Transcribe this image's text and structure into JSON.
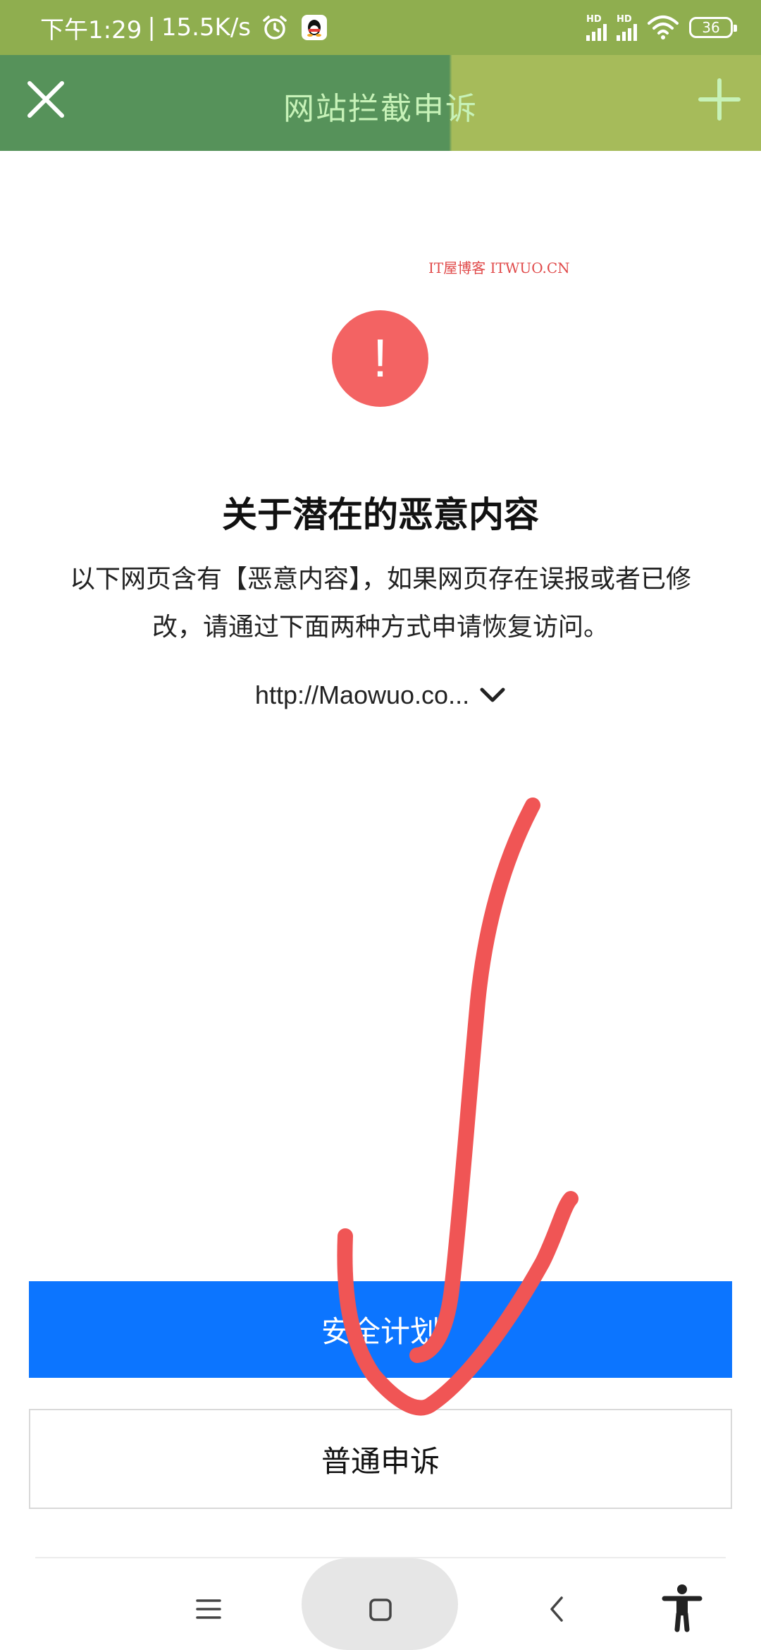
{
  "status_bar": {
    "time": "下午1:29",
    "separator": "|",
    "network_speed": "15.5K/s",
    "signal_label_1": "HD",
    "signal_label_2": "HD",
    "battery": "36",
    "icons": [
      "alarm-icon",
      "qq-icon",
      "signal-icon",
      "wifi-icon",
      "battery-icon"
    ]
  },
  "title_bar": {
    "title": "网站拦截申诉",
    "left_icon": "close-icon",
    "right_icon": "plus-icon"
  },
  "content": {
    "watermark": "IT屋博客 ITWUO.CN",
    "alert_symbol": "!",
    "heading": "关于潜在的恶意内容",
    "description": "以下网页含有【恶意内容】，如果网页存在误报或者已修改，请通过下面两种方式申请恢复访问。",
    "url": "http://Maowuo.co...",
    "url_expand_icon": "chevron-down-icon"
  },
  "buttons": {
    "primary": "安全计划",
    "secondary": "普通申诉"
  },
  "nav_bar": {
    "items": [
      "menu-icon",
      "home-icon",
      "back-icon",
      "accessibility-icon"
    ]
  },
  "colors": {
    "status_bar": "#8fae4f",
    "title_bar_left": "#56925a",
    "title_bar_right": "#a6bb5a",
    "title_text": "#c7f2b8",
    "alert": "#f36363",
    "primary_button": "#0c75ff",
    "annotation_stroke": "#f05555",
    "watermark": "#e04a4a"
  }
}
